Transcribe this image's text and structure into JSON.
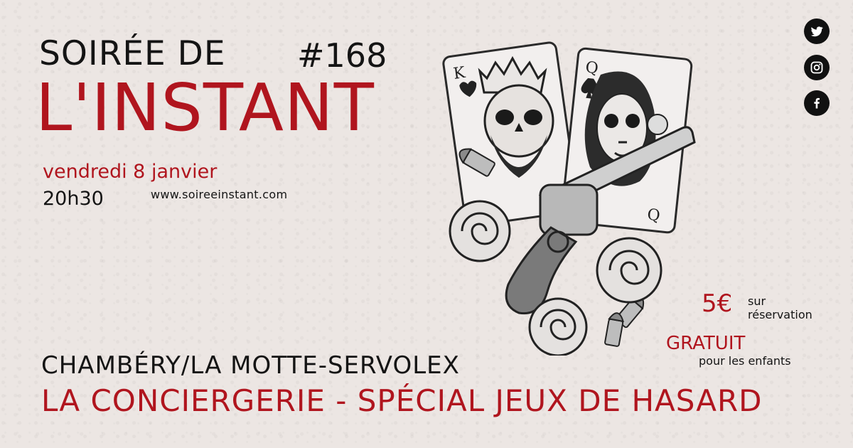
{
  "event": {
    "title_line1": "SOIRÉE DE",
    "issue": "#168",
    "title_line2": "L'INSTANT",
    "date": "vendredi 8 janvier",
    "time": "20h30",
    "website": "www.soireeinstant.com",
    "city": "CHAMBÉRY/LA MOTTE-SERVOLEX",
    "venue": "LA CONCIERGERIE - SPÉCIAL JEUX DE HASARD"
  },
  "pricing": {
    "price": "5€",
    "price_note_line1": "sur",
    "price_note_line2": "réservation",
    "free_label": "GRATUIT",
    "free_note": "pour les enfants"
  },
  "illustration": {
    "card_king_rank": "K",
    "card_queen_rank": "Q",
    "card_queen_rank_bottom": "Q"
  },
  "social": {
    "icons": [
      "twitter-icon",
      "instagram-icon",
      "facebook-icon"
    ]
  },
  "colors": {
    "accent_red": "#b0151e",
    "text_dark": "#141414",
    "background": "#ece6e3"
  }
}
